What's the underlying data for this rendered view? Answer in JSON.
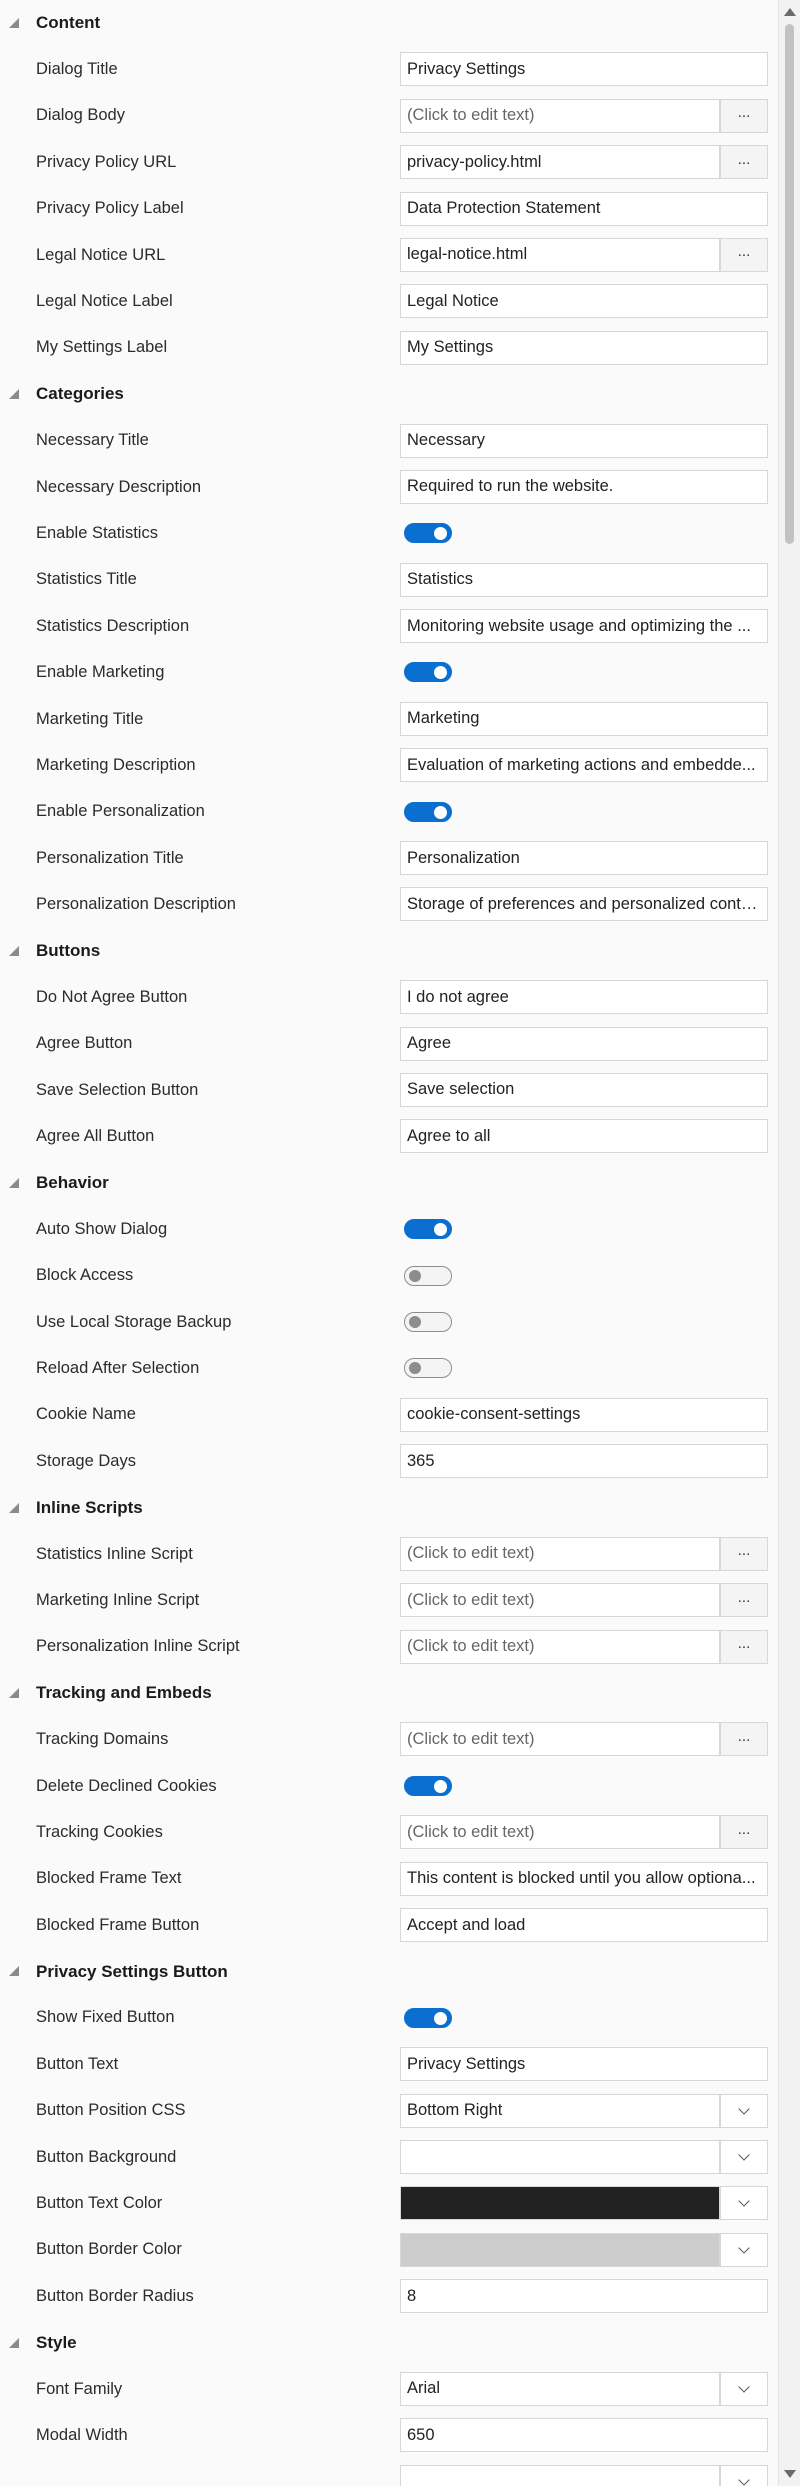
{
  "colors": {
    "toggle_on": "#0a6fd1",
    "button_text_color_swatch": "#222222",
    "button_border_color_swatch": "#cccccc",
    "button_background_swatch": "#ffffff"
  },
  "more_button_label": "...",
  "sections": [
    {
      "title": "Content",
      "props": [
        {
          "label": "Dialog Title",
          "type": "text",
          "value": "Privacy Settings"
        },
        {
          "label": "Dialog Body",
          "type": "dialog",
          "value": "(Click to edit text)",
          "placeholder": true
        },
        {
          "label": "Privacy Policy URL",
          "type": "dialog",
          "value": "privacy-policy.html"
        },
        {
          "label": "Privacy Policy Label",
          "type": "text",
          "value": "Data Protection Statement"
        },
        {
          "label": "Legal Notice URL",
          "type": "dialog",
          "value": "legal-notice.html"
        },
        {
          "label": "Legal Notice Label",
          "type": "text",
          "value": "Legal Notice"
        },
        {
          "label": "My Settings Label",
          "type": "text",
          "value": "My Settings"
        }
      ]
    },
    {
      "title": "Categories",
      "props": [
        {
          "label": "Necessary Title",
          "type": "text",
          "value": "Necessary"
        },
        {
          "label": "Necessary Description",
          "type": "text",
          "value": "Required to run the website."
        },
        {
          "label": "Enable Statistics",
          "type": "toggle",
          "on": true
        },
        {
          "label": "Statistics Title",
          "type": "text",
          "value": "Statistics"
        },
        {
          "label": "Statistics Description",
          "type": "text",
          "value": "Monitoring website usage and optimizing the ..."
        },
        {
          "label": "Enable Marketing",
          "type": "toggle",
          "on": true
        },
        {
          "label": "Marketing Title",
          "type": "text",
          "value": "Marketing"
        },
        {
          "label": "Marketing Description",
          "type": "text",
          "value": "Evaluation of marketing actions and embedde..."
        },
        {
          "label": "Enable Personalization",
          "type": "toggle",
          "on": true
        },
        {
          "label": "Personalization Title",
          "type": "text",
          "value": "Personalization"
        },
        {
          "label": "Personalization Description",
          "type": "text",
          "value": "Storage of preferences and personalized conte..."
        }
      ]
    },
    {
      "title": "Buttons",
      "props": [
        {
          "label": "Do Not Agree Button",
          "type": "text",
          "value": "I do not agree"
        },
        {
          "label": "Agree Button",
          "type": "text",
          "value": "Agree"
        },
        {
          "label": "Save Selection Button",
          "type": "text",
          "value": "Save selection"
        },
        {
          "label": "Agree All Button",
          "type": "text",
          "value": "Agree to all"
        }
      ]
    },
    {
      "title": "Behavior",
      "props": [
        {
          "label": "Auto Show Dialog",
          "type": "toggle",
          "on": true
        },
        {
          "label": "Block Access",
          "type": "toggle",
          "on": false
        },
        {
          "label": "Use Local Storage Backup",
          "type": "toggle",
          "on": false
        },
        {
          "label": "Reload After Selection",
          "type": "toggle",
          "on": false
        },
        {
          "label": "Cookie Name",
          "type": "text",
          "value": "cookie-consent-settings"
        },
        {
          "label": "Storage Days",
          "type": "text",
          "value": "365"
        }
      ]
    },
    {
      "title": "Inline Scripts",
      "props": [
        {
          "label": "Statistics Inline Script",
          "type": "dialog",
          "value": "(Click to edit text)",
          "placeholder": true
        },
        {
          "label": "Marketing Inline Script",
          "type": "dialog",
          "value": "(Click to edit text)",
          "placeholder": true
        },
        {
          "label": "Personalization Inline Script",
          "type": "dialog",
          "value": "(Click to edit text)",
          "placeholder": true
        }
      ]
    },
    {
      "title": "Tracking and Embeds",
      "props": [
        {
          "label": "Tracking Domains",
          "type": "dialog",
          "value": "(Click to edit text)",
          "placeholder": true
        },
        {
          "label": "Delete Declined Cookies",
          "type": "toggle",
          "on": true
        },
        {
          "label": "Tracking Cookies",
          "type": "dialog",
          "value": "(Click to edit text)",
          "placeholder": true
        },
        {
          "label": "Blocked Frame Text",
          "type": "text",
          "value": "This content is blocked until you allow optiona..."
        },
        {
          "label": "Blocked Frame Button",
          "type": "text",
          "value": "Accept and load"
        }
      ]
    },
    {
      "title": "Privacy Settings Button",
      "props": [
        {
          "label": "Show Fixed Button",
          "type": "toggle",
          "on": true
        },
        {
          "label": "Button Text",
          "type": "text",
          "value": "Privacy Settings"
        },
        {
          "label": "Button Position CSS",
          "type": "combo",
          "value": "Bottom Right"
        },
        {
          "label": "Button Background",
          "type": "color",
          "color": "#ffffff"
        },
        {
          "label": "Button Text Color",
          "type": "color",
          "color": "#222222"
        },
        {
          "label": "Button Border Color",
          "type": "color",
          "color": "#cccccc"
        },
        {
          "label": "Button Border Radius",
          "type": "text",
          "value": "8"
        }
      ]
    },
    {
      "title": "Style",
      "props": [
        {
          "label": "Font Family",
          "type": "combo",
          "value": "Arial"
        },
        {
          "label": "Modal Width",
          "type": "text",
          "value": "650"
        },
        {
          "label": "",
          "type": "combo",
          "value": ""
        }
      ]
    }
  ]
}
